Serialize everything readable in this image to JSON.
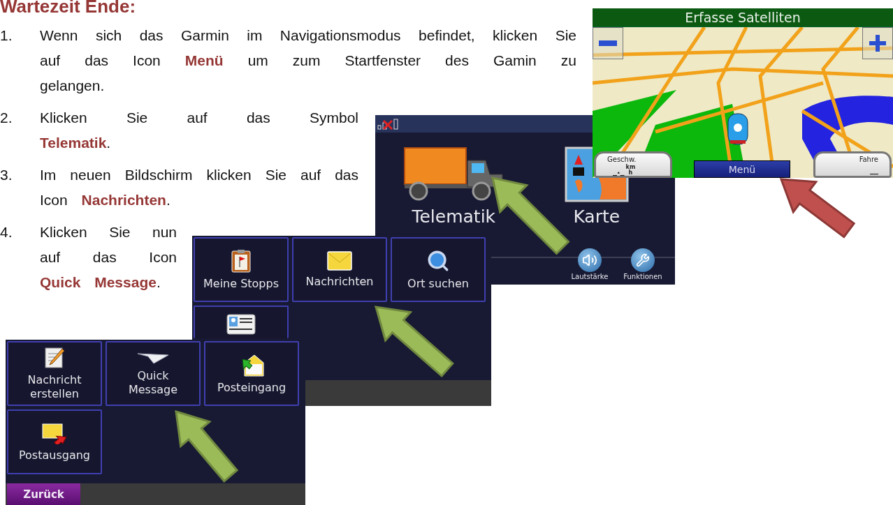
{
  "heading": "Wartezeit Ende:",
  "steps": [
    {
      "number": "1.",
      "text": "Wenn sich das Garmin im Navigationsmodus befindet, klicken Sie auf das Icon **Menü** um zum Startfenster des Gamin zu gelangen."
    },
    {
      "number": "2.",
      "text": "Klicken Sie auf das Symbol **Telematik**."
    },
    {
      "number": "3.",
      "text": "Im neuen Bildschirm klicken Sie auf das Icon **Nachrichten**."
    },
    {
      "number": "4.",
      "text": "Klicken Sie nun auf das Icon **Quick Message**."
    }
  ],
  "map_screen": {
    "title": "Erfasse Satelliten",
    "speed_label": "Geschw.",
    "speed_value": "_._",
    "speed_unit_top": "km",
    "speed_unit_bottom": "h",
    "menu_button": "Menü",
    "trip_label": "Fahre",
    "trip_value": "__"
  },
  "home_screen": {
    "items": [
      {
        "label": "Telematik"
      },
      {
        "label": "Karte"
      }
    ],
    "buttons": [
      {
        "label": "Lautstärke"
      },
      {
        "label": "Funktionen"
      }
    ]
  },
  "telematik_screen": {
    "tiles": [
      {
        "label": "Meine Stopps"
      },
      {
        "label": "Nachrichten"
      },
      {
        "label": "Ort suchen"
      },
      {
        "kind": "icon"
      }
    ]
  },
  "messages_screen": {
    "tiles": [
      {
        "label": "Nachricht\nerstellen"
      },
      {
        "label": "Quick\nMessage"
      },
      {
        "label": "Posteingang"
      },
      {
        "label": "Postausgang"
      }
    ],
    "back_button": "Zurück"
  }
}
